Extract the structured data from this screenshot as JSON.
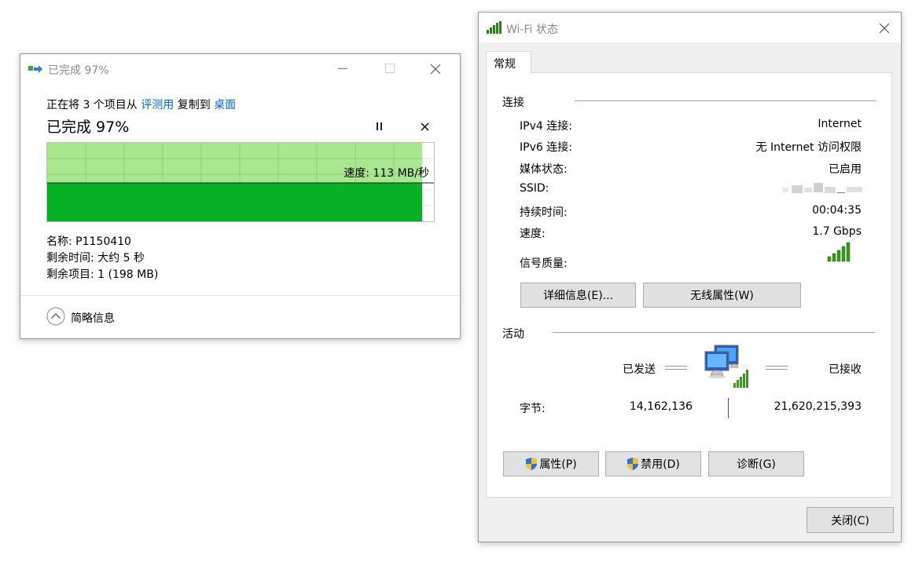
{
  "copy": {
    "title": "已完成 97%",
    "desc_prefix": "正在将 3 个项目从 ",
    "from_link": "评测用",
    "desc_mid": " 复制到 ",
    "to_link": "桌面",
    "heading": "已完成 97%",
    "speed": "速度: 113 MB/秒",
    "progress_fraction": 0.97,
    "name": "名称: P1150410",
    "time_left": "剩余时间: 大约 5 秒",
    "items_left": "剩余项目: 1 (198 MB)",
    "less_details": "简略信息"
  },
  "wifi": {
    "title": "Wi-Fi 状态",
    "tab": "常规",
    "connection_header": "连接",
    "rows": [
      {
        "label": "IPv4 连接:",
        "value": "Internet"
      },
      {
        "label": "IPv6 连接:",
        "value": "无 Internet 访问权限"
      },
      {
        "label": "媒体状态:",
        "value": "已启用"
      },
      {
        "label": "SSID:",
        "value": ""
      },
      {
        "label": "持续时间:",
        "value": "00:04:35"
      },
      {
        "label": "速度:",
        "value": "1.7 Gbps"
      }
    ],
    "signal_label": "信号质量:",
    "details_button": "详细信息(E)...",
    "wireless_props_button": "无线属性(W)",
    "activity_header": "活动",
    "sent_label": "已发送",
    "received_label": "已接收",
    "bytes_label": "字节:",
    "bytes_sent": "14,162,136",
    "bytes_received": "21,620,215,393",
    "properties_button": "属性(P)",
    "disable_button": "禁用(D)",
    "diagnose_button": "诊断(G)",
    "close_button": "关闭(C)"
  },
  "colors": {
    "link": "#0066cc",
    "progress_light": "#a8e68f",
    "progress_dark": "#06b025",
    "signal": "#3a9a1e"
  }
}
